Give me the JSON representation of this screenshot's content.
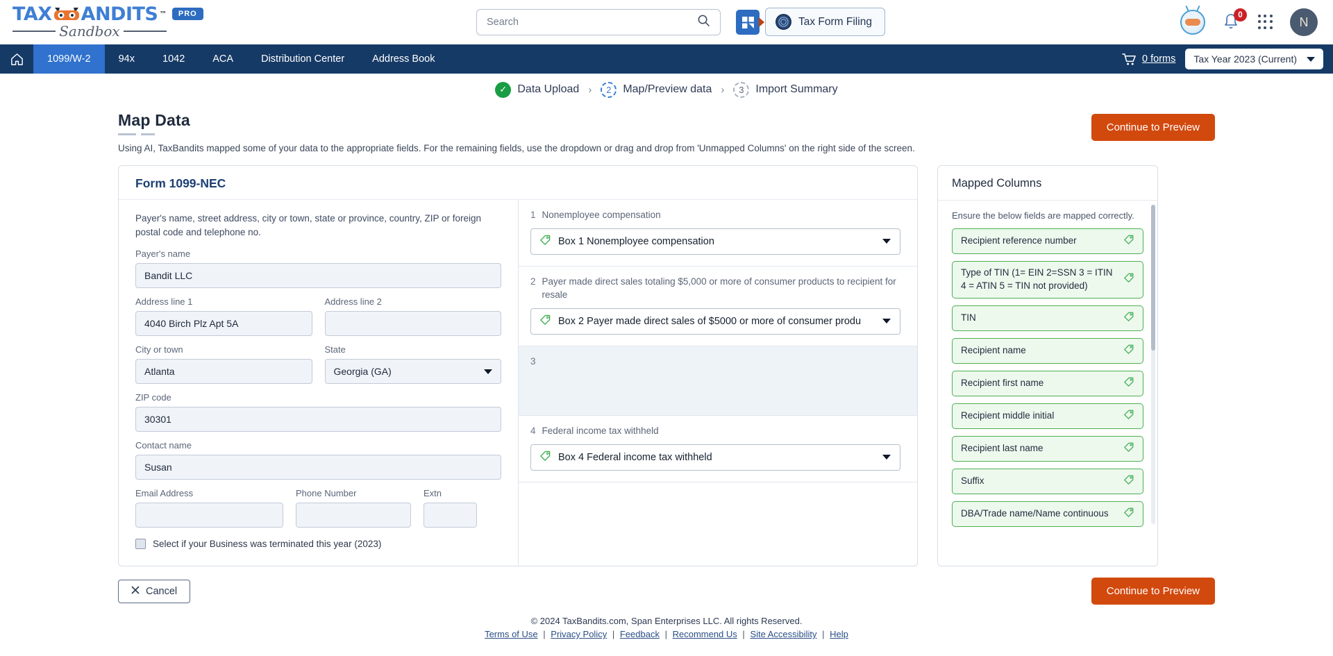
{
  "brand": {
    "logo_main": "TAX",
    "logo_main_2": "ANDITS",
    "logo_tm": "™",
    "logo_sub": "Sandbox",
    "pro_badge": "PRO",
    "accent_blue": "#3f7fd4",
    "nav_blue": "#163a66",
    "accent_orange": "#d2490e",
    "chip_green": "#4caf50"
  },
  "header": {
    "search_placeholder": "Search",
    "search_value": "",
    "tax_form_filing": "Tax Form Filing",
    "notification_count": "0",
    "avatar_initial": "N"
  },
  "nav": {
    "items": [
      {
        "label": "1099/W-2",
        "active": true
      },
      {
        "label": "94x",
        "active": false
      },
      {
        "label": "1042",
        "active": false
      },
      {
        "label": "ACA",
        "active": false
      },
      {
        "label": "Distribution Center",
        "active": false
      },
      {
        "label": "Address Book",
        "active": false
      }
    ],
    "cart_label": "0 forms",
    "tax_year": "Tax Year 2023 (Current)"
  },
  "stepper": {
    "steps": [
      {
        "marker": "✓",
        "label": "Data Upload",
        "state": "done"
      },
      {
        "marker": "2",
        "label": "Map/Preview data",
        "state": "active"
      },
      {
        "marker": "3",
        "label": "Import Summary",
        "state": "todo"
      }
    ],
    "separator": "›"
  },
  "page": {
    "title": "Map Data",
    "subtitle": "Using AI, TaxBandits mapped some of your data to the appropriate fields. For the remaining fields, use the dropdown or drag and drop from 'Unmapped Columns' on the right side of the screen.",
    "continue_label": "Continue to Preview",
    "cancel_label": "Cancel"
  },
  "form": {
    "card_title": "Form 1099-NEC",
    "payer_description": "Payer's name, street address, city or town, state or province, country, ZIP or foreign postal code and telephone no.",
    "fields": {
      "payer_name_label": "Payer's name",
      "payer_name_value": "Bandit LLC",
      "address1_label": "Address line 1",
      "address1_value": "4040 Birch Plz Apt 5A",
      "address2_label": "Address line 2",
      "address2_value": "",
      "city_label": "City or town",
      "city_value": "Atlanta",
      "state_label": "State",
      "state_value": "Georgia (GA)",
      "zip_label": "ZIP code",
      "zip_value": "30301",
      "contact_label": "Contact name",
      "contact_value": "Susan",
      "email_label": "Email Address",
      "email_value": "",
      "phone_label": "Phone Number",
      "phone_value": "",
      "extn_label": "Extn",
      "extn_value": ""
    },
    "terminated_checkbox_label": "Select if your Business was terminated this year (2023)",
    "terminated_checked": false,
    "boxes": [
      {
        "number": "1",
        "label": "Nonemployee compensation",
        "mapped_value": "Box 1 Nonemployee compensation",
        "has_select": true
      },
      {
        "number": "2",
        "label": "Payer made direct sales totaling $5,000 or more of consumer products to recipient for resale",
        "mapped_value": "Box 2 Payer made direct sales of $5000 or more of consumer produ",
        "has_select": true
      },
      {
        "number": "3",
        "label": "",
        "mapped_value": "",
        "has_select": false
      },
      {
        "number": "4",
        "label": "Federal income tax withheld",
        "mapped_value": "Box 4 Federal income tax withheld",
        "has_select": true
      }
    ]
  },
  "mapped_panel": {
    "title": "Mapped Columns",
    "subtitle": "Ensure the below fields are mapped correctly.",
    "chips": [
      "Recipient reference number",
      "Type of TIN (1= EIN 2=SSN 3 = ITIN 4 = ATIN 5 = TIN not provided)",
      "TIN",
      "Recipient name",
      "Recipient first name",
      "Recipient middle initial",
      "Recipient last name",
      "Suffix",
      "DBA/Trade name/Name continuous"
    ]
  },
  "site_footer": {
    "copyright": "© 2024 TaxBandits.com, Span Enterprises LLC. All rights Reserved.",
    "links": [
      "Terms of Use",
      "Privacy Policy",
      "Feedback",
      "Recommend Us",
      "Site Accessibility",
      "Help"
    ],
    "link_separator": "|"
  }
}
